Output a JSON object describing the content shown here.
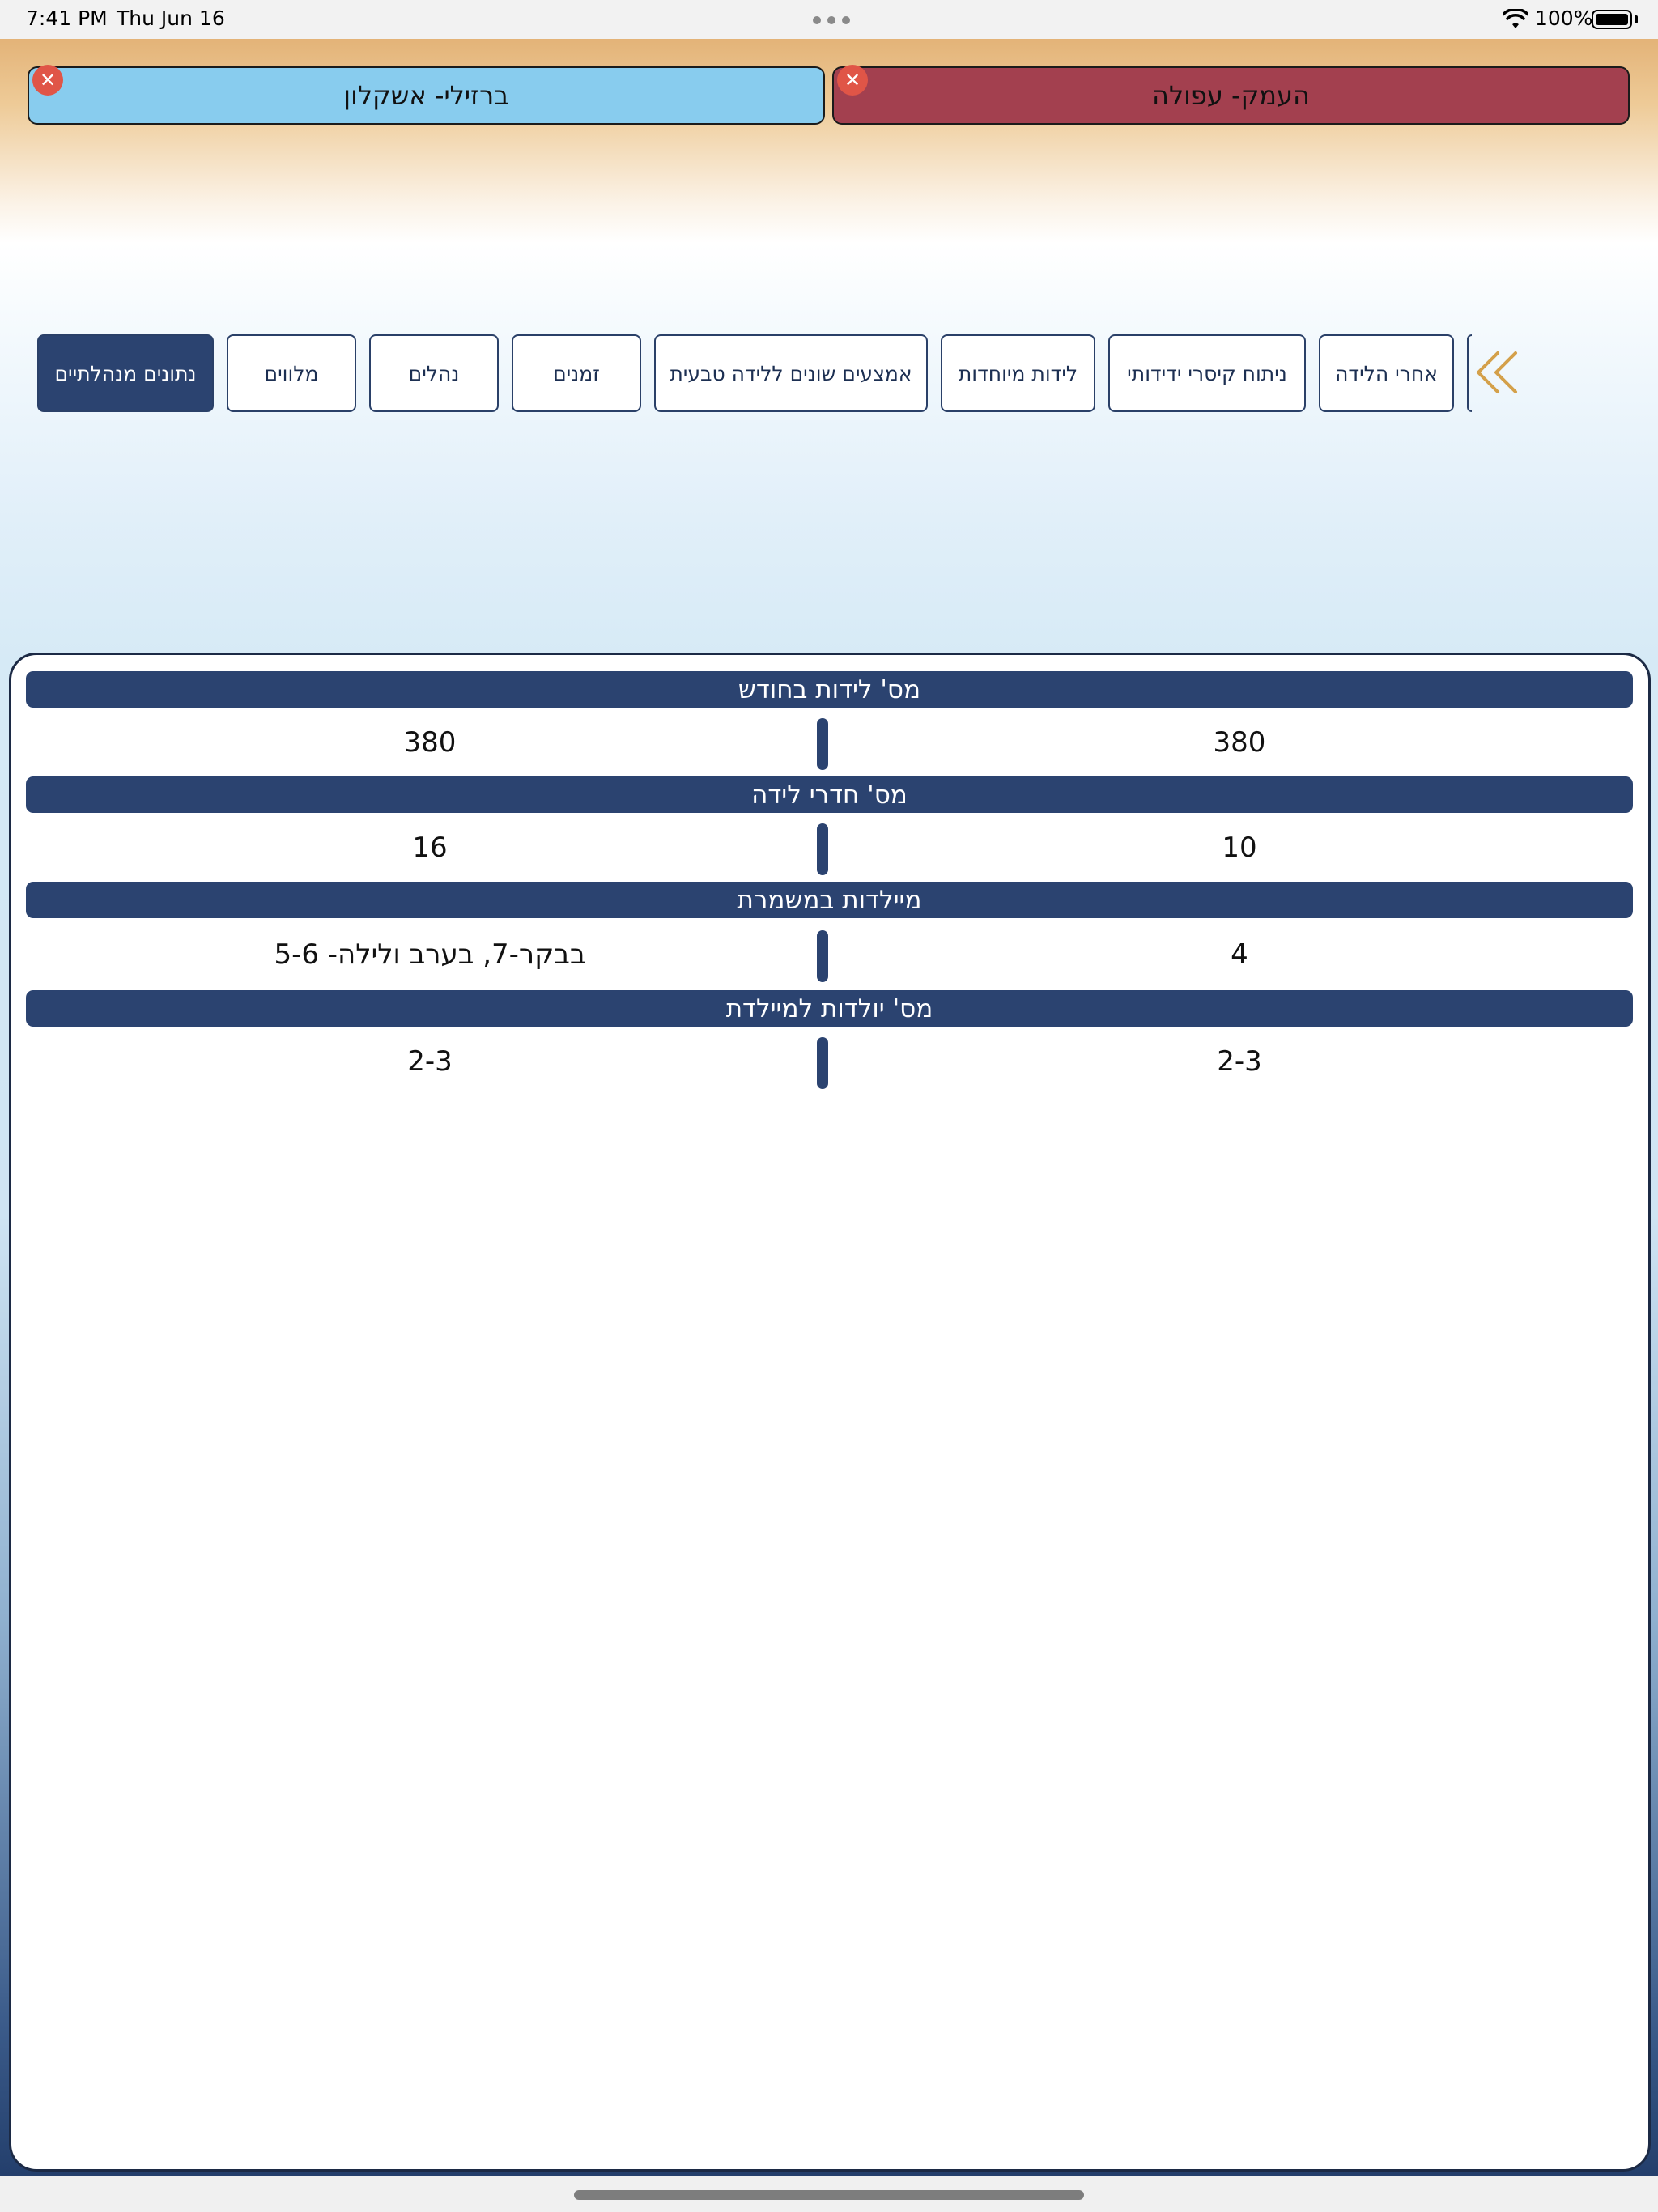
{
  "status_bar": {
    "time": "7:41 PM",
    "date": "Thu Jun 16",
    "battery": "100%"
  },
  "hospitals": {
    "left": {
      "name": "ברזילי- אשקלון",
      "color": "#88ccee"
    },
    "right": {
      "name": "העמק- עפולה",
      "color": "#a3404f"
    }
  },
  "categories": [
    {
      "label": "נתונים מנהלתיים",
      "active": true
    },
    {
      "label": "מלווים",
      "active": false
    },
    {
      "label": "נהלים",
      "active": false
    },
    {
      "label": "זמנים",
      "active": false
    },
    {
      "label": "אמצעים שונים ללידה טבעית",
      "active": false
    },
    {
      "label": "לידות מיוחדות",
      "active": false
    },
    {
      "label": "ניתוח קיסרי ידידותי",
      "active": false
    },
    {
      "label": "אחרי הלידה",
      "active": false
    }
  ],
  "comparison": [
    {
      "title": "מס' לידות בחודש",
      "left": "380",
      "right": "380"
    },
    {
      "title": "מס' חדרי לידה",
      "left": "16",
      "right": "10"
    },
    {
      "title": "מיילדות במשמרת",
      "left": "בבקר-7, בערב ולילה- 5-6",
      "right": "4"
    },
    {
      "title": "מס' יולדות למיילדת",
      "left": "2-3",
      "right": "2-3"
    }
  ],
  "icons": {
    "close": "close-icon",
    "scroll": "double-chevron-left-icon",
    "accent": "#d4a04a"
  }
}
